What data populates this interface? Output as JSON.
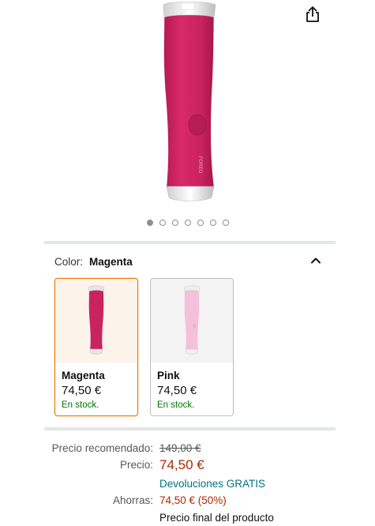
{
  "gallery": {
    "image_count": 7,
    "active_index": 0
  },
  "product": {
    "brand_mark": "FOREO",
    "colors": {
      "magenta": "#c92360",
      "pink": "#f5c0da",
      "selected_border": "#e77600",
      "stock_green": "#007600",
      "price_red": "#b12704",
      "link_teal": "#007185"
    }
  },
  "variation": {
    "label": "Color:",
    "selected": "Magenta",
    "options": [
      {
        "name": "Magenta",
        "price": "74,50 €",
        "stock": "En stock."
      },
      {
        "name": "Pink",
        "price": "74,50 €",
        "stock": "En stock."
      }
    ]
  },
  "pricing": {
    "rrp_label": "Precio recomendado:",
    "rrp_value": "149,00 €",
    "price_label": "Precio:",
    "price_value": "74,50 €",
    "returns_text": "Devoluciones GRATIS",
    "savings_label": "Ahorras:",
    "savings_value": "74,50 € (50%)",
    "final_price_note": "Precio final del producto"
  },
  "icons": {
    "share": "share-icon",
    "collapse": "chevron-up-icon"
  }
}
